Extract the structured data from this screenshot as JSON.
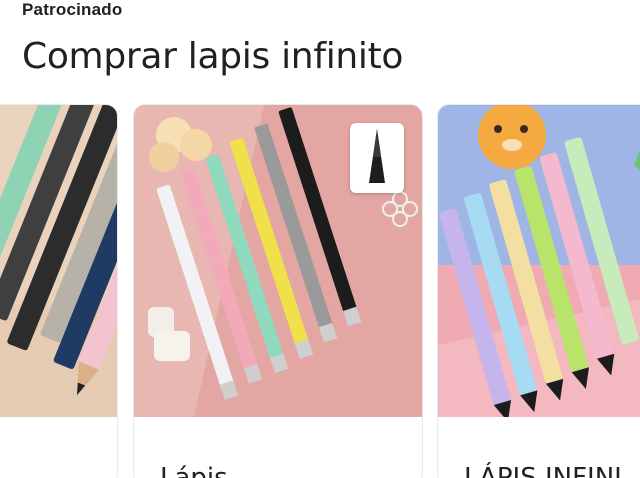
{
  "ad": {
    "sponsored_label": "Patrocinado",
    "heading": "Comprar lapis infinito"
  },
  "products": [
    {
      "title": ""
    },
    {
      "title": "Lápis..."
    },
    {
      "title": "LÁPIS INFINI..."
    }
  ],
  "colors": {
    "card_border": "#e8eaed",
    "text": "#202124",
    "card2_bg": "#e3a6a2",
    "card3_bg": "#9fb5e6"
  },
  "icons": {
    "thumb": "pencil-tip-icon",
    "flower": "flower-outline-icon"
  }
}
